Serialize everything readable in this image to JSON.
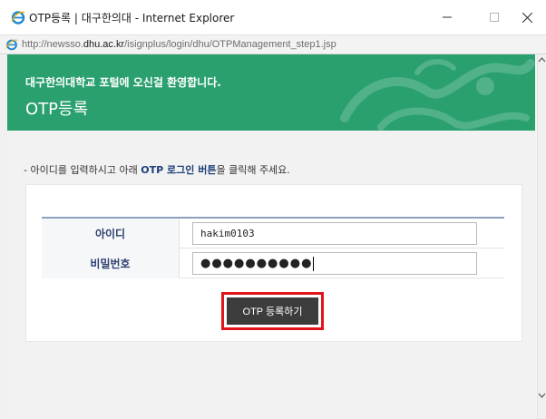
{
  "window": {
    "title": "OTP등록 | 대구한의대 - Internet Explorer",
    "url_prefix": "http://newsso.",
    "url_domain": "dhu.ac.kr",
    "url_path": "/isignplus/login/dhu/OTPManagement_step1.jsp"
  },
  "header": {
    "welcome": "대구한의대학교 포털에 오신걸 환영합니다.",
    "title": "OTP등록"
  },
  "instruction": {
    "prefix": "- 아이디를 입력하시고 아래 ",
    "emphasis": "OTP 로그인 버튼",
    "suffix": "을 클릭해 주세요."
  },
  "form": {
    "id_label": "아이디",
    "id_value": "hakim0103",
    "pw_label": "비밀번호",
    "pw_value": "●●●●●●●●●●",
    "submit_label": "OTP 등록하기"
  },
  "colors": {
    "header_green": "#2aa06f",
    "label_navy": "#2c3e6d",
    "highlight_red": "#e0141b",
    "button_dark": "#3c3c3c"
  },
  "icons": [
    "ie-logo-icon",
    "minimize-icon",
    "maximize-icon",
    "close-icon",
    "scroll-up-icon",
    "scroll-down-icon"
  ]
}
